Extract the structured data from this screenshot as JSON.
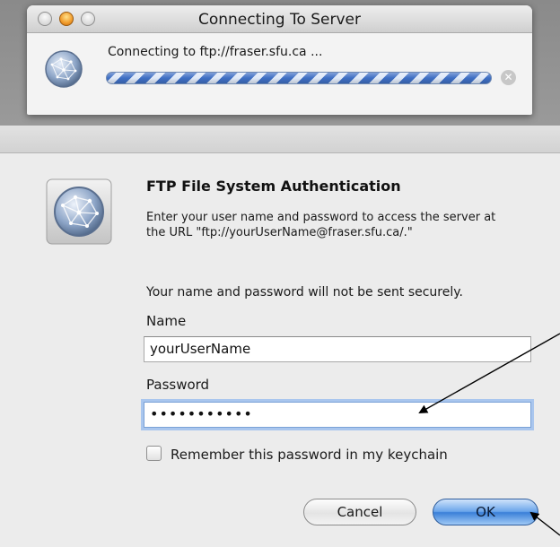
{
  "connecting_window": {
    "title": "Connecting To Server",
    "status": "Connecting to ftp://fraser.sfu.ca ...",
    "icon": "network-globe-icon",
    "stop_icon": "stop-x-icon"
  },
  "auth_dialog": {
    "icon": "network-globe-icon",
    "title": "FTP File System Authentication",
    "description": "Enter your user name and password to access the server at the URL \"ftp://yourUserName@fraser.sfu.ca/.\"",
    "warning": "Your name and password will not be sent securely.",
    "name_label": "Name",
    "name_value": "yourUserName",
    "password_label": "Password",
    "password_value": "•••••••••••",
    "remember_label": "Remember this password in my keychain",
    "remember_checked": false,
    "cancel_label": "Cancel",
    "ok_label": "OK"
  },
  "colors": {
    "accent": "#3a7fd8",
    "progress_stripe": "#3f6fc4",
    "focus_ring": "#a9c6ee"
  }
}
